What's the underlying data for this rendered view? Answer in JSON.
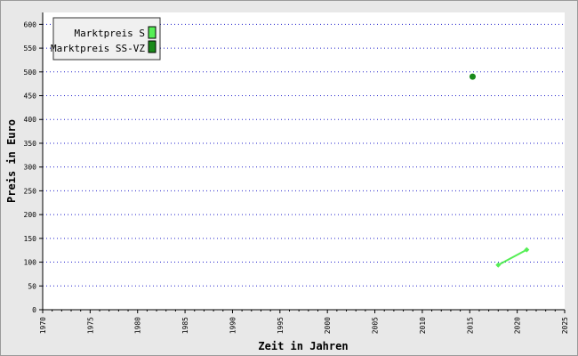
{
  "chart_data": {
    "type": "line",
    "xlabel": "Zeit in Jahren",
    "ylabel": "Preis in Euro",
    "xlim": [
      1970,
      2025
    ],
    "ylim": [
      0,
      625
    ],
    "x_ticks": [
      "1970",
      "1975",
      "1980",
      "1985",
      "1990",
      "1995",
      "2000",
      "2005",
      "2010",
      "2015",
      "2020",
      "2025"
    ],
    "y_ticks": [
      "0",
      "50",
      "100",
      "150",
      "200",
      "250",
      "300",
      "350",
      "400",
      "450",
      "500",
      "550",
      "600"
    ],
    "grid": "horizontal dotted",
    "legend_position": "top-left",
    "series": [
      {
        "name": "Marktpreis S",
        "color": "#55ee55",
        "points": [
          {
            "x": 2018,
            "y": 94
          },
          {
            "x": 2021,
            "y": 126
          }
        ]
      },
      {
        "name": "Marktpreis SS-VZ",
        "color": "#1a8a1a",
        "points": [
          {
            "x": 2015.3,
            "y": 490
          }
        ]
      }
    ]
  }
}
